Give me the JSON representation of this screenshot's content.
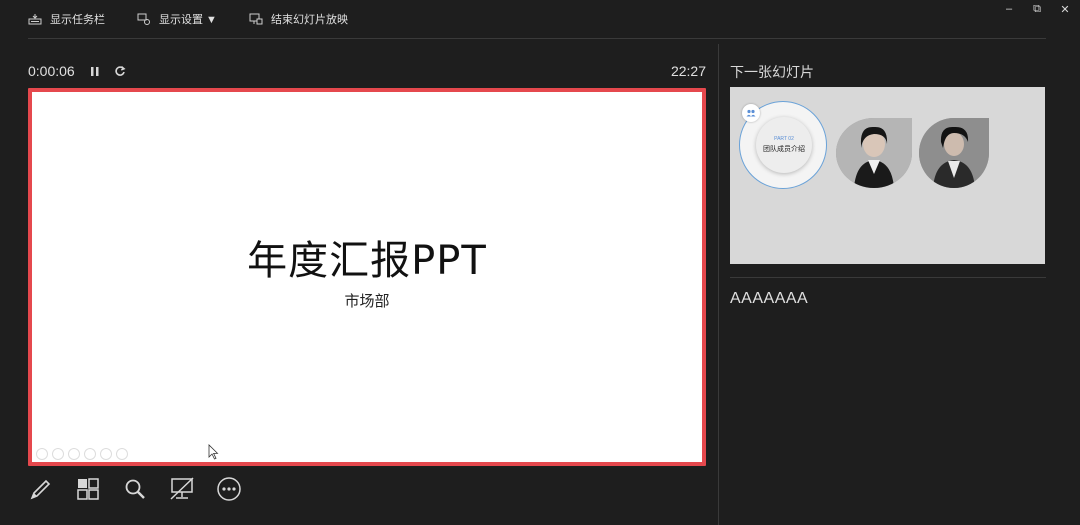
{
  "toolbar": {
    "show_taskbar": "显示任务栏",
    "display_settings": "显示设置 ▼",
    "end_slideshow": "结束幻灯片放映"
  },
  "window_controls": {
    "minimize": "–",
    "restore": "⧉",
    "close": "✕"
  },
  "timer": {
    "elapsed": "0:00:06",
    "clock": "22:27"
  },
  "slide": {
    "title": "年度汇报PPT",
    "subtitle": "市场部"
  },
  "next_slide": {
    "label": "下一张幻灯片",
    "part": "PART 02",
    "heading": "团队成员介绍"
  },
  "notes": {
    "text": "AAAAAAA"
  },
  "icons": {
    "show_taskbar": "taskbar-icon",
    "display_settings": "display-settings-icon",
    "end_slideshow": "end-slideshow-icon",
    "pause": "pause-icon",
    "restart": "restart-icon",
    "pen": "pen-icon",
    "all_slides": "all-slides-icon",
    "zoom": "zoom-icon",
    "black_screen": "black-screen-icon",
    "more": "more-options-icon"
  },
  "colors": {
    "accent_border": "#e5484d",
    "background": "#1e1e1e",
    "circle_ring": "#6aa2d8"
  }
}
